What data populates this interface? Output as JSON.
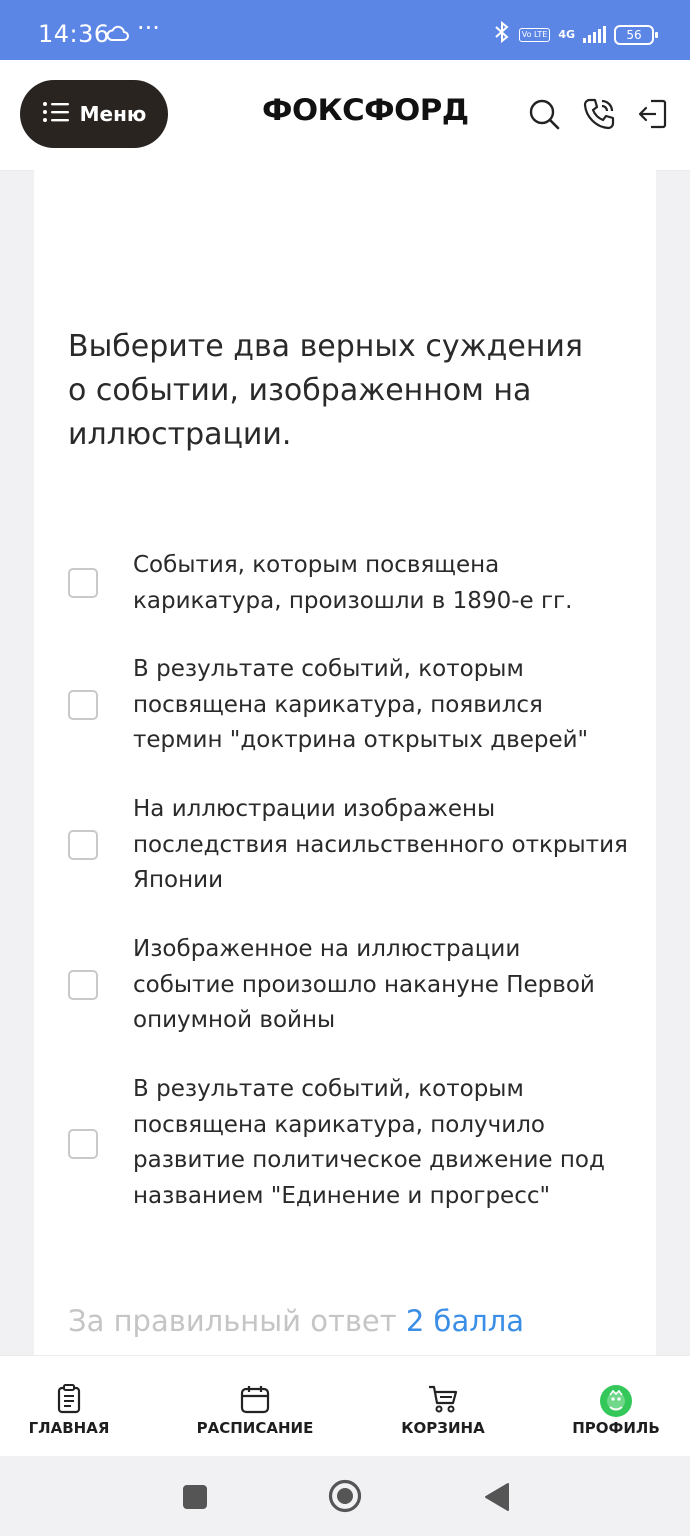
{
  "status_bar": {
    "time": "14:36",
    "dots": "···",
    "volte": "Vo LTE",
    "network": "4G",
    "battery": "56"
  },
  "header": {
    "menu_label": "Меню",
    "logo": "ФОКСФОРД"
  },
  "question": {
    "text": "Выберите два верных суждения о событии, изображенном на иллюстрации.",
    "options": [
      {
        "text": "События, которым посвящена карикатура, произошли в 1890-е гг.",
        "checked": false
      },
      {
        "text": "В результате событий, которым посвящена карикатура, появился термин \"доктрина открытых дверей\"",
        "checked": false
      },
      {
        "text": "На иллюстрации изображены последствия насильственного открытия Японии",
        "checked": false
      },
      {
        "text": "Изображенное на иллюстрации событие произошло накануне Первой опиумной войны",
        "checked": false
      },
      {
        "text": "В результате событий, которым посвящена карикатура, получило развитие политическое движение под названием \"Единение и прогресс\"",
        "checked": false
      }
    ],
    "score_prefix": "За правильный ответ",
    "score_points": "2 балла"
  },
  "tabs": [
    {
      "label": "ГЛАВНАЯ",
      "icon": "document-icon"
    },
    {
      "label": "РАСПИСАНИЕ",
      "icon": "calendar-icon"
    },
    {
      "label": "КОРЗИНА",
      "icon": "cart-icon"
    },
    {
      "label": "ПРОФИЛЬ",
      "icon": "profile-avatar-icon"
    }
  ],
  "colors": {
    "status_bar": "#5c86e6",
    "menu_button": "#2a2421",
    "accent_blue": "#3a8ee6",
    "profile_green": "#34c759"
  }
}
